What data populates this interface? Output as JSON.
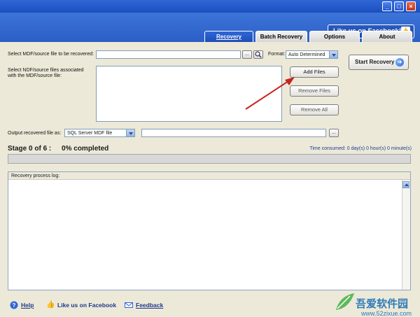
{
  "header": {
    "facebook_like": "Like us on Facebook!"
  },
  "window_controls": {
    "minimize": "_",
    "maximize": "□",
    "close": "×"
  },
  "tabs": [
    {
      "label": "Recovery",
      "active": true
    },
    {
      "label": "Batch Recovery",
      "active": false
    },
    {
      "label": "Options",
      "active": false
    },
    {
      "label": "About",
      "active": false
    }
  ],
  "form": {
    "mdf_label": "Select MDF/source file to be recovered:",
    "mdf_value": "",
    "browse_label": "...",
    "format_label": "Format:",
    "format_value": "Auto Determined",
    "ndf_label_line1": "Select NDF/source files associated",
    "ndf_label_line2": "with the MDF/source file:",
    "add_files": "Add Files",
    "remove_files": "Remove Files",
    "remove_all": "Remove All",
    "output_label": "Output recovered file as:",
    "output_type": "SQL Server MDF file",
    "output_path": "",
    "output_browse": "..."
  },
  "start_recovery": "Start Recovery",
  "status": {
    "stage": "Stage 0 of 6 :",
    "percent": "0% completed",
    "time_label": "Time consumed:",
    "time_value": "0 day(s) 0 hour(s) 0 minute(s)",
    "progress": 0
  },
  "log": {
    "title": "Recovery process log:"
  },
  "footer": {
    "help": "Help",
    "facebook": "Like us on Facebook",
    "feedback": "Feedback"
  },
  "watermark": {
    "text": "吾爱软件园",
    "url": "www.52zixue.com"
  },
  "colors": {
    "title_bar": "#1b4fbf",
    "accent": "#2f66d6",
    "panel": "#ece9d8",
    "arrow": "#c8231f"
  }
}
